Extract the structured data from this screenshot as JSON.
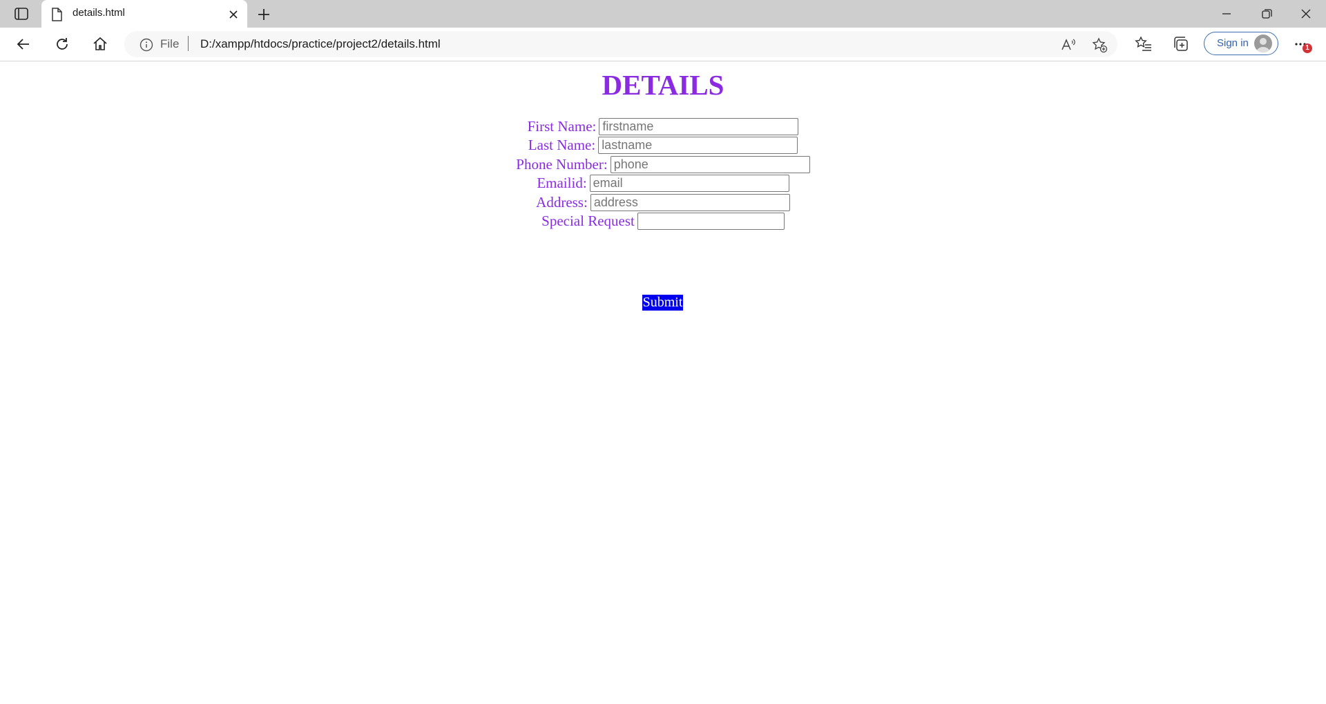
{
  "browser": {
    "tab": {
      "title": "details.html"
    },
    "address": {
      "scheme_label": "File",
      "url": "D:/xampp/htdocs/practice/project2/details.html"
    },
    "signin_label": "Sign in",
    "notification_count": "1",
    "accent_color": "#2e61b0"
  },
  "page": {
    "heading": "DETAILS",
    "heading_color": "#8a2be2",
    "fields": [
      {
        "label": "First Name:",
        "placeholder": "firstname",
        "value": ""
      },
      {
        "label": "Last Name:",
        "placeholder": "lastname",
        "value": ""
      },
      {
        "label": "Phone Number:",
        "placeholder": "phone",
        "value": ""
      },
      {
        "label": "Emailid:",
        "placeholder": "email",
        "value": ""
      },
      {
        "label": "Address:",
        "placeholder": "address",
        "value": ""
      },
      {
        "label": "Special Request",
        "placeholder": "",
        "value": ""
      }
    ],
    "submit_label": "Submit",
    "submit_color": "#0000ee"
  }
}
